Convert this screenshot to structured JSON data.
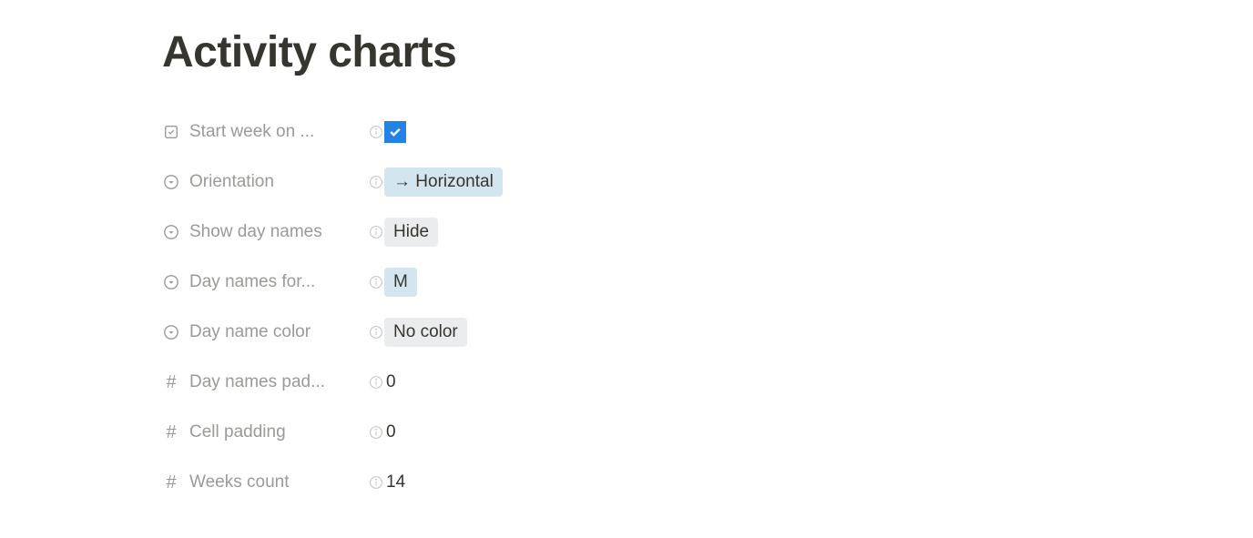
{
  "title": "Activity charts",
  "properties": {
    "start_week": {
      "label": "Start week on ...",
      "checked": true
    },
    "orientation": {
      "label": "Orientation",
      "value": "→ Horizontal"
    },
    "show_day_names": {
      "label": "Show day names",
      "value": "Hide"
    },
    "day_names_format": {
      "label": "Day names for...",
      "value": "M"
    },
    "day_name_color": {
      "label": "Day name color",
      "value": "No color"
    },
    "day_names_padding": {
      "label": "Day names pad...",
      "value": "0"
    },
    "cell_padding": {
      "label": "Cell padding",
      "value": "0"
    },
    "weeks_count": {
      "label": "Weeks count",
      "value": "14"
    }
  }
}
